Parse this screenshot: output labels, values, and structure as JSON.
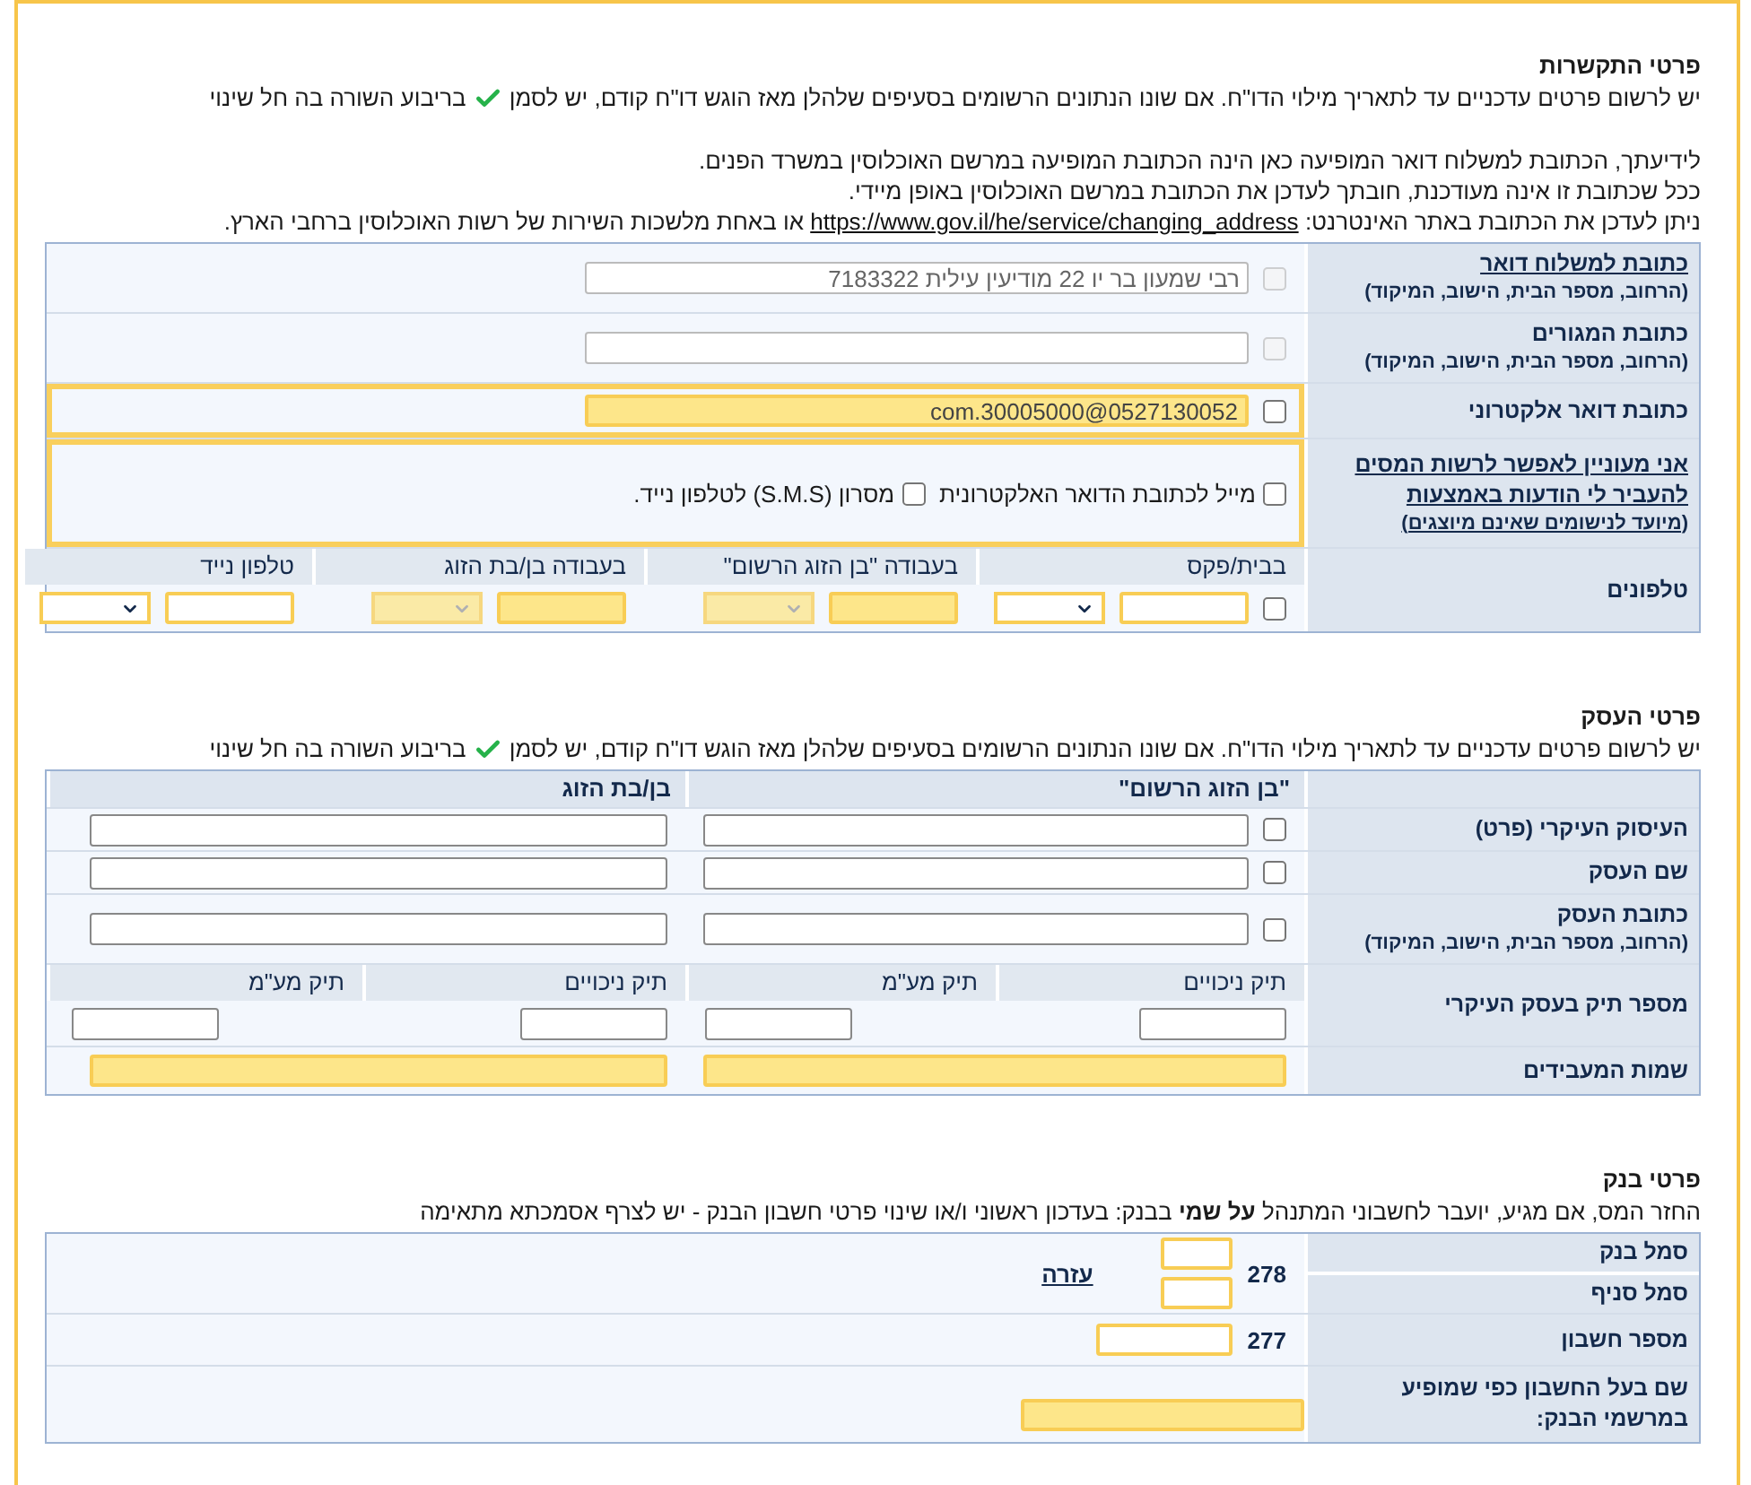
{
  "contact": {
    "title": "פרטי התקשרות",
    "note": "יש לרשום פרטים עדכניים עד לתאריך מילוי הדו\"ח. אם שונו הנתונים הרשומים בסעיפים שלהלן מאז הוגש דו\"ח קודם, יש לסמן",
    "note_end": "בריבוע השורה בה חל שינוי",
    "info": [
      "לידיעתך, הכתובת למשלוח דואר המופיעה כאן הינה הכתובת המופיעה במרשם האוכלוסין במשרד הפנים.",
      "ככל שכתובת זו אינה מעודכנת, חובתך לעדכן את הכתובת במרשם האוכלוסין באופן מיידי."
    ],
    "link_line": {
      "before": "ניתן לעדכן את הכתובת באתר האינטרנט:",
      "link": "https://www.gov.il/he/service/changing_address",
      "after": "או באחת מלשכות השירות של רשות האוכלוסין ברחבי הארץ."
    },
    "rows": [
      {
        "kind": "address",
        "label": "כתובת למשלוח דואר",
        "link": true,
        "sublabel": "(הרחוב, מספר הבית, הישוב, המיקוד)",
        "checked": false,
        "disabled": true,
        "value": "רבי שמעון בר יו 22 מודיעין עילית 7183322"
      },
      {
        "kind": "address",
        "label": "כתובת המגורים",
        "link": false,
        "sublabel": "(הרחוב, מספר הבית, הישוב, המיקוד)",
        "checked": false,
        "disabled": true
      },
      {
        "kind": "email",
        "label": "כתובת דואר אלקטרוני",
        "checked": false,
        "value": "com.30005000@0527130052",
        "filled": true
      },
      {
        "kind": "consent",
        "label": "אני מעוניין לאפשר לרשות המסים להעביר לי הודעות באמצעות",
        "sublabel": "(מיועד לנישומים שאינם מיוצגים)",
        "options": [
          {
            "label": "מייל לכתובת הדואר האלקטרונית",
            "checked": false
          },
          {
            "label": "מסרון (S.M.S) לטלפון נייד.",
            "checked": false
          }
        ]
      },
      {
        "kind": "phones",
        "label": "טלפונים",
        "groups": [
          {
            "heading": "בבית/פקס",
            "checked": false,
            "filled": false,
            "disabled": false
          },
          {
            "heading": "בעבודה \"בן הזוג הרשום\"",
            "filled": true,
            "disabled": true
          },
          {
            "heading": "בעבודה בן/בת הזוג",
            "filled": true,
            "disabled": true
          },
          {
            "heading": "טלפון נייד",
            "filled": false,
            "disabled": false
          }
        ]
      }
    ]
  },
  "business": {
    "title": "פרטי העסק",
    "note": "יש לרשום פרטים עדכניים עד לתאריך מילוי הדו\"ח. אם שונו הנתונים הרשומים בסעיפים שלהלן מאז הוגש דו\"ח קודם, יש לסמן",
    "note_end": "בריבוע השורה בה חל שינוי",
    "columns": [
      "\"בן הזוג הרשום\"",
      "בן/בת הזוג"
    ],
    "rows": [
      {
        "label": "העיסוק העיקרי (פרט)",
        "checked": false
      },
      {
        "label": "שם העסק",
        "checked": false
      },
      {
        "label": "כתובת העסק",
        "sublabel": "(הרחוב, מספר הבית, הישוב, המיקוד)",
        "checked": false
      }
    ],
    "file_row": {
      "label": "מספר תיק בעסק העיקרי",
      "headings": [
        "תיק ניכויים",
        "תיק מע\"מ",
        "תיק ניכויים",
        "תיק מע\"מ"
      ]
    },
    "employers_row": {
      "label": "שמות המעבידים",
      "filled": true
    }
  },
  "bank": {
    "title": "פרטי בנק",
    "note": "החזר המס, אם מגיע, יועבר לחשבוני המתנהל **על שמי** בבנק: בעדכון ראשוני ו/או שינוי פרטי חשבון הבנק - יש לצרף אסמכתא מתאימה",
    "rows": [
      {
        "kind": "pair",
        "labels": [
          "סמל בנק",
          "סמל סניף"
        ],
        "code": "278",
        "help": "עזרה",
        "filled": false
      },
      {
        "kind": "account",
        "label": "מספר חשבון",
        "code": "277",
        "filled": false
      },
      {
        "kind": "owner",
        "label": "שם בעל החשבון כפי שמופיע במרשמי הבנק:",
        "filled": true
      }
    ]
  }
}
